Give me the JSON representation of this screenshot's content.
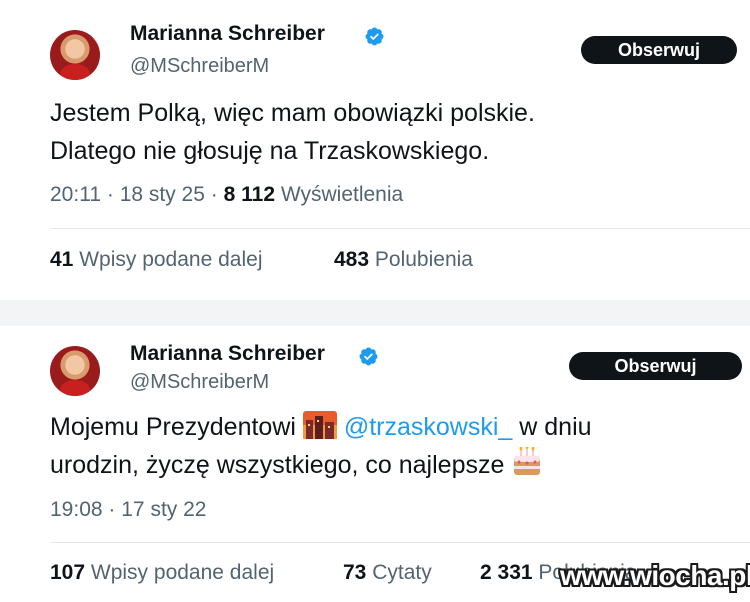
{
  "tweets": [
    {
      "author_name": "Marianna Schreiber",
      "handle": "@MSchreiberM",
      "follow_label": "Obserwuj",
      "text_line1": "Jestem Polką, więc mam obowiązki polskie.",
      "text_line2": "Dlatego nie głosuję na Trzaskowskiego.",
      "time": "20:11",
      "date": "18 sty 25",
      "views_count": "8 112",
      "views_label": "Wyświetlenia",
      "reposts_count": "41",
      "reposts_label": "Wpisy podane dalej",
      "likes_count": "483",
      "likes_label": "Polubienia"
    },
    {
      "author_name": "Marianna Schreiber",
      "handle": "@MSchreiberM",
      "follow_label": "Obserwuj",
      "text_line1_before": "Mojemu Prezydentowi",
      "mention": "@trzaskowski_",
      "text_line1_after": "w dniu",
      "text_line2": "urodzin, życzę wszystkiego, co najlepsze",
      "time": "19:08",
      "date": "17 sty 22",
      "reposts_count": "107",
      "reposts_label": "Wpisy podane dalej",
      "quotes_count": "73",
      "quotes_label": "Cytaty",
      "likes_count": "2 331",
      "likes_label": "Polubienia"
    }
  ],
  "separator": "·",
  "icons": {
    "verified": "verified-badge-icon",
    "city_emoji": "cityscape-at-dusk-icon",
    "cake_emoji": "birthday-cake-icon"
  },
  "colors": {
    "text": "#0f1419",
    "secondary": "#536471",
    "link": "#1d9bf0",
    "verified": "#1d9bf0",
    "button": "#0f1419"
  },
  "watermark": "www.wiocha.pl"
}
